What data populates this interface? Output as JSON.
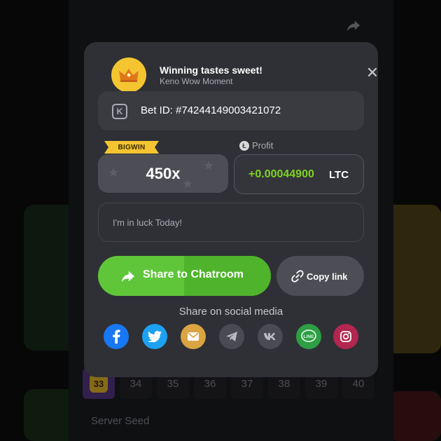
{
  "modal": {
    "title": "Winning tastes sweet!",
    "subtitle": "Keno Wow Moment",
    "bet_id": "Bet ID: #74244149003421072",
    "bigwin_label": "BIGWIN",
    "multiplier": "450x",
    "profit_label": "Profit",
    "profit_value": "+0.00044900",
    "profit_currency": "LTC",
    "message_placeholder": "I'm in luck Today!",
    "share_button": "Share to Chatroom",
    "copy_button": "Copy link",
    "social_heading": "Share on social media",
    "social_icons": [
      "facebook-icon",
      "twitter-icon",
      "email-icon",
      "telegram-icon",
      "vk-icon",
      "line-icon",
      "instagram-icon"
    ]
  },
  "keno": {
    "hit_number": "33",
    "numbers": [
      "34",
      "35",
      "36",
      "37",
      "38",
      "39",
      "40"
    ],
    "server_seed_label": "Server Seed"
  },
  "colors": {
    "modal_bg": "#2f3035",
    "accent_green": "#5fc63a",
    "profit_green": "#7ed321",
    "gold": "#f4c531"
  }
}
